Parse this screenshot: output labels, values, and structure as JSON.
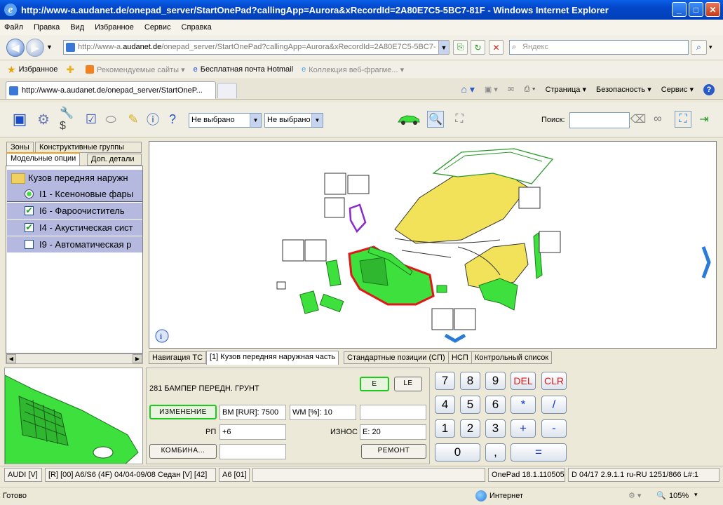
{
  "window": {
    "title": "http://www-a.audanet.de/onepad_server/StartOnePad?callingApp=Aurora&xRecordId=2A80E7C5-5BC7-81F - Windows Internet Explorer"
  },
  "menu": [
    "Файл",
    "Правка",
    "Вид",
    "Избранное",
    "Сервис",
    "Справка"
  ],
  "address": {
    "prefix": "http://www-a.",
    "domain": "audanet.de",
    "rest": "/onepad_server/StartOnePad?callingApp=Aurora&xRecordId=2A80E7C5-5BC7-"
  },
  "search_placeholder": "Яндекс",
  "favorites": {
    "fav_label": "Избранное",
    "items": [
      "Рекомендуемые сайты ▾",
      "Бесплатная почта Hotmail",
      "Коллекция веб-фрагме... ▾"
    ]
  },
  "tab": {
    "title": "http://www-a.audanet.de/onepad_server/StartOneP..."
  },
  "commands": [
    "Страница ▾",
    "Безопасность ▾",
    "Сервис ▾"
  ],
  "toolbar": {
    "dropdown1": "Не выбрано",
    "dropdown2": "Не выбрано",
    "search_label": "Поиск:"
  },
  "left_tabs": {
    "row1": [
      "Зоны",
      "Конструктивные группы"
    ],
    "row2": [
      "Модельные опции",
      "Доп. детали"
    ]
  },
  "tree": [
    {
      "label": "Кузов передняя наружн",
      "kind": "folder"
    },
    {
      "label": "I1 - Ксеноновые фары",
      "kind": "radio"
    },
    {
      "label": "I6 - Фароочиститель",
      "kind": "checked"
    },
    {
      "label": "I4 - Акустическая сист",
      "kind": "checked"
    },
    {
      "label": "I9 - Автоматическая р",
      "kind": "unchecked"
    }
  ],
  "bottom_tabs": [
    "Навигация ТС",
    "[1] Кузов передняя наружная часть",
    "Стандартные позиции (СП)",
    "НСП",
    "Контрольный список"
  ],
  "detail": {
    "part": "281 БАМПЕР ПЕРЕДН. ГРУНТ",
    "btn_e": "E",
    "btn_le": "LE",
    "btn_change": "ИЗМЕНЕНИЕ",
    "bm": "BM [RUR]: 7500",
    "wm": "WM [%]: 10",
    "rp_label": "РП",
    "rp_value": "+6",
    "wear_label": "ИЗНОС",
    "wear_value": "E: 20",
    "btn_combo": "КОМБИНА...",
    "btn_repair": "РЕМОНТ"
  },
  "keypad": {
    "k7": "7",
    "k8": "8",
    "k9": "9",
    "del": "DEL",
    "clr": "CLR",
    "k4": "4",
    "k5": "5",
    "k6": "6",
    "mul": "*",
    "div": "/",
    "k1": "1",
    "k2": "2",
    "k3": "3",
    "plus": "+",
    "minus": "-",
    "k0": "0",
    "comma": ",",
    "eq": "="
  },
  "status": {
    "s1": "AUDI [V]",
    "s2": "[R] [00] A6/S6 (4F) 04/04-09/08 Седан [V] [42]",
    "s3": "A6 [01]",
    "s4": "OnePad 18.1.110505",
    "s5": "D  04/17 2.9.1.1 ru-RU 1251/866 L#:1"
  },
  "ie_status": {
    "left": "Готово",
    "zone": "Интернет",
    "zoom": "105%"
  },
  "colors": {
    "xp_blue": "#0346c8",
    "part_green": "#3ee03e",
    "hood_yellow": "#f2e25a",
    "highlight_red": "#e01818",
    "tree_select": "#b5b9e0"
  }
}
